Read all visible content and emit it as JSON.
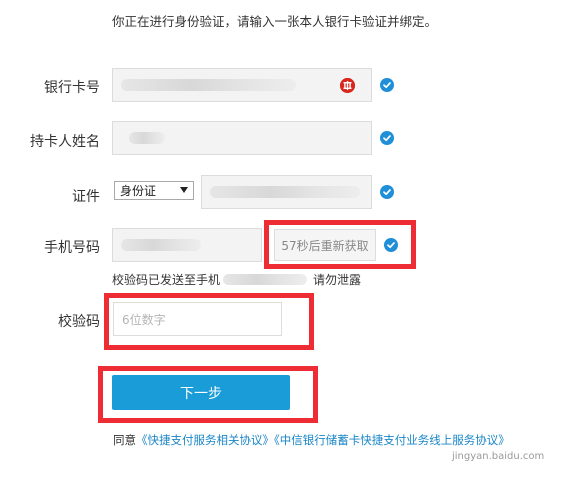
{
  "intro_text": "你正在进行身份验证，请输入一张本人银行卡验证并绑定。",
  "bank_card": {
    "label": "银行卡号"
  },
  "cardholder": {
    "label": "持卡人姓名"
  },
  "id_doc": {
    "label": "证件",
    "selected": "身份证"
  },
  "phone": {
    "label": "手机号码",
    "resend_label": "57秒后重新获取"
  },
  "sms_note": {
    "prefix": "校验码已发送至手机",
    "suffix": "请勿泄露"
  },
  "verify_code": {
    "label": "校验码",
    "placeholder": "6位数字"
  },
  "next_button": {
    "label": "下一步"
  },
  "agreement": {
    "prefix": "同意",
    "link1": "《快捷支付服务相关协议》",
    "link2": "《中信银行储蓄卡快捷支付业务线上服务协议》"
  },
  "watermark": "jingyan.baidu.com",
  "colors": {
    "accent": "#1a9cd8",
    "check_blue": "#1e8fd8",
    "highlight_red": "#ee2c34",
    "bank_logo_red": "#d8271c"
  },
  "icons": {
    "check": "check-circle-icon",
    "bank_logo": "citic-bank-logo-icon",
    "select_arrow": "chevron-down-icon"
  }
}
